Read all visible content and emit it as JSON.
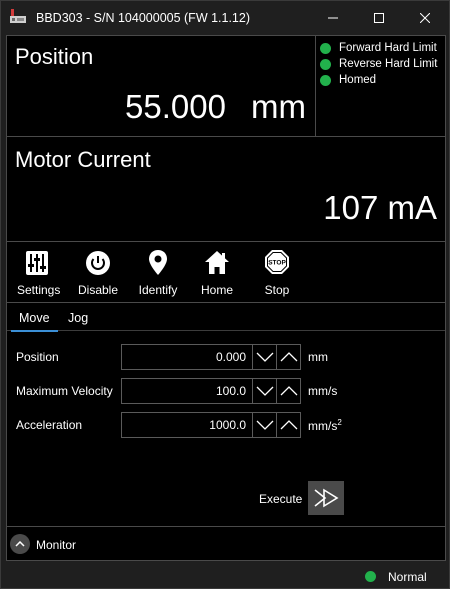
{
  "window": {
    "title": "BBD303 - S/N 104000005 (FW 1.1.12)"
  },
  "position": {
    "label": "Position",
    "value": "55.000",
    "unit": "mm"
  },
  "limits": [
    {
      "label": "Forward Hard Limit",
      "color": "#22b14c"
    },
    {
      "label": "Reverse Hard Limit",
      "color": "#22b14c"
    },
    {
      "label": "Homed",
      "color": "#22b14c"
    }
  ],
  "motor_current": {
    "label": "Motor Current",
    "value": "107 mA"
  },
  "toolbar": {
    "settings": {
      "label": "Settings",
      "icon": "sliders-icon"
    },
    "disable": {
      "label": "Disable",
      "icon": "power-icon"
    },
    "identify": {
      "label": "Identify",
      "icon": "map-pin-icon"
    },
    "home": {
      "label": "Home",
      "icon": "home-icon"
    },
    "stop": {
      "label": "Stop",
      "icon": "stop-sign-icon",
      "sign_text": "STOP"
    }
  },
  "tabs": [
    {
      "label": "Move",
      "active": true
    },
    {
      "label": "Jog",
      "active": false
    }
  ],
  "move": {
    "position": {
      "label": "Position",
      "value": "0.000",
      "unit": "mm"
    },
    "max_velocity": {
      "label": "Maximum Velocity",
      "value": "100.0",
      "unit": "mm/s"
    },
    "acceleration": {
      "label": "Acceleration",
      "value": "1000.0",
      "unit": "mm/s",
      "unit_sup": "2"
    },
    "execute_label": "Execute"
  },
  "monitor": {
    "label": "Monitor"
  },
  "status": {
    "text": "Normal",
    "color": "#22b14c"
  }
}
